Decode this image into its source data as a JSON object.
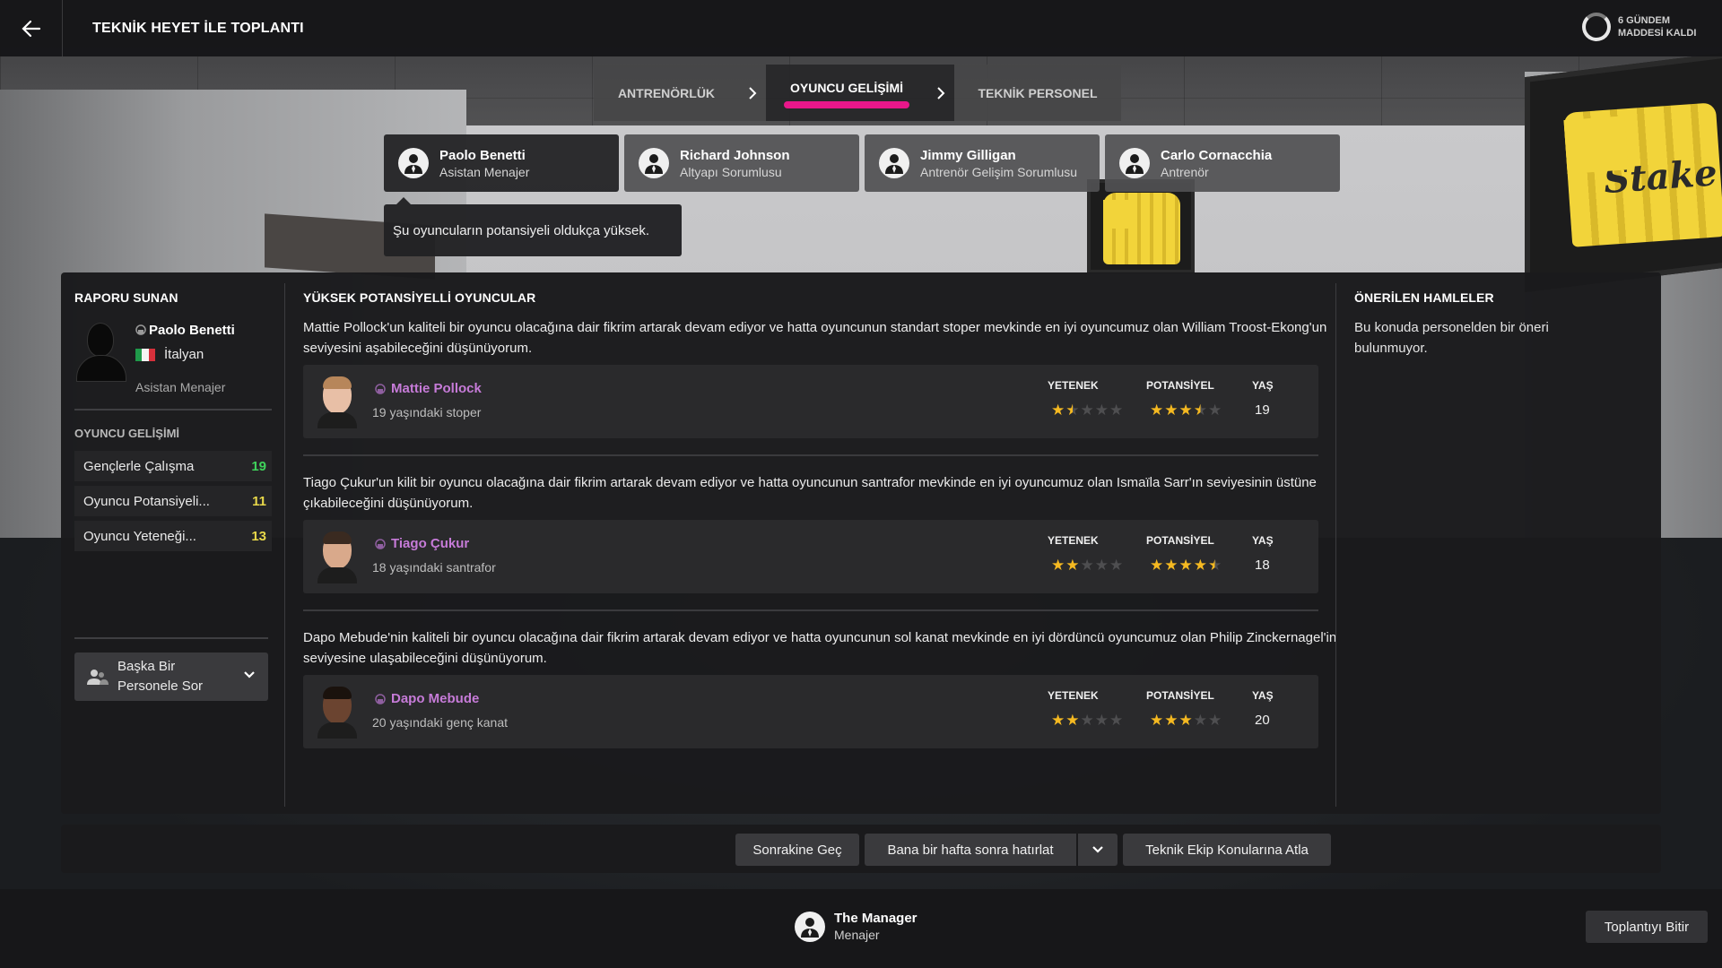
{
  "header": {
    "title": "TEKNİK HEYET İLE TOPLANTI",
    "agenda_line1": "6 GÜNDEM",
    "agenda_line2": "MADDESİ KALDI"
  },
  "stages": [
    {
      "label": "ANTRENÖRLÜK",
      "active": false
    },
    {
      "label": "OYUNCU GELİŞİMİ",
      "active": true
    },
    {
      "label": "TEKNİK PERSONEL",
      "active": false
    }
  ],
  "staff": [
    {
      "name": "Paolo Benetti",
      "role": "Asistan Menajer"
    },
    {
      "name": "Richard Johnson",
      "role": "Altyapı Sorumlusu"
    },
    {
      "name": "Jimmy Gilligan",
      "role": "Antrenör Gelişim Sorumlusu"
    },
    {
      "name": "Carlo Cornacchia",
      "role": "Antrenör"
    }
  ],
  "speech": "Şu oyuncuların potansiyeli oldukça yüksek.",
  "presenter": {
    "heading": "RAPORU SUNAN",
    "name": "Paolo Benetti",
    "nationality": "İtalyan",
    "role": "Asistan Menajer",
    "section": "OYUNCU GELİŞİMİ",
    "attributes": [
      {
        "label": "Gençlerle Çalışma",
        "value": "19",
        "color": "#3fd35b"
      },
      {
        "label": "Oyuncu Potansiyeli...",
        "value": "11",
        "color": "#e8d84a"
      },
      {
        "label": "Oyuncu Yeteneği...",
        "value": "13",
        "color": "#e8d84a"
      }
    ],
    "ask_line1": "Başka Bir",
    "ask_line2": "Personele Sor"
  },
  "report": {
    "heading": "YÜKSEK POTANSİYELLİ OYUNCULAR",
    "col_ability": "YETENEK",
    "col_potential": "POTANSİYEL",
    "col_age": "YAŞ",
    "items": [
      {
        "text": "Mattie Pollock'un kaliteli bir oyuncu olacağına dair fikrim artarak devam ediyor ve hatta oyuncunun standart stoper mevkinde en iyi oyuncumuz olan William Troost-Ekong'un seviyesini aşabileceğini düşünüyorum.",
        "name": "Mattie Pollock",
        "desc": "19 yaşındaki stoper",
        "ability": 1.5,
        "potential": 3.5,
        "age": "19"
      },
      {
        "text": "Tiago Çukur'un kilit bir oyuncu olacağına dair fikrim artarak devam ediyor ve hatta oyuncunun santrafor mevkinde en iyi oyuncumuz olan Ismaïla Sarr'ın seviyesinin üstüne çıkabileceğini düşünüyorum.",
        "name": "Tiago Çukur",
        "desc": "18 yaşındaki santrafor",
        "ability": 2,
        "potential": 4.5,
        "age": "18"
      },
      {
        "text": "Dapo Mebude'nin kaliteli bir oyuncu olacağına dair fikrim artarak devam ediyor ve hatta oyuncunun sol kanat mevkinde en iyi dördüncü oyuncumuz olan Philip Zinckernagel'in seviyesine ulaşabileceğini düşünüyorum.",
        "name": "Dapo Mebude",
        "desc": "20 yaşındaki genç kanat",
        "ability": 2,
        "potential": 3,
        "age": "20"
      }
    ]
  },
  "suggestions": {
    "heading": "ÖNERİLEN HAMLELER",
    "text": "Bu konuda personelden bir öneri bulunmuyor."
  },
  "actions": {
    "skip": "Sonrakine Geç",
    "remind": "Bana bir hafta sonra hatırlat",
    "jump": "Teknik Ekip Konularına Atla"
  },
  "manager": {
    "name": "The Manager",
    "role": "Menajer"
  },
  "end_button": "Toplantıyı Bitir"
}
